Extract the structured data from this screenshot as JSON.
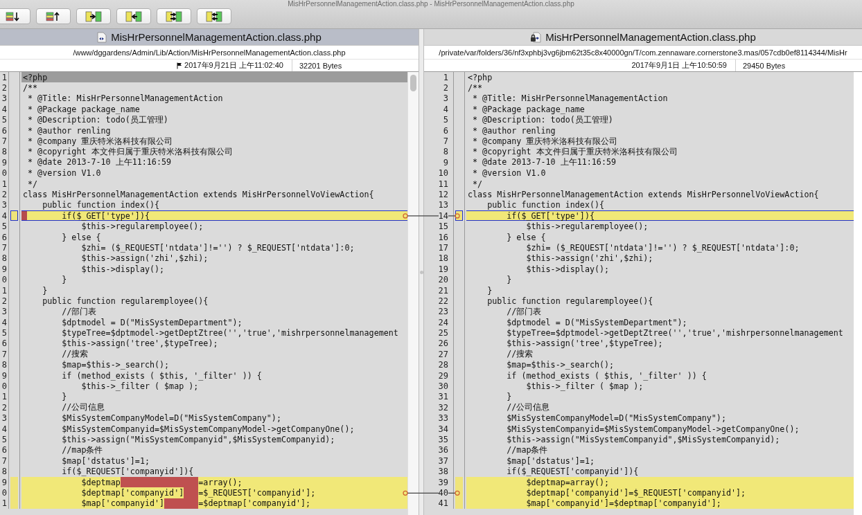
{
  "window": {
    "title": "MisHrPersonnelManagementAction.class.php - MisHrPersonnelManagementAction.class.php"
  },
  "toolbar": {
    "buttons": [
      {
        "kind": "bars-down"
      },
      {
        "kind": "bars-up"
      },
      {
        "kind": "copy-right"
      },
      {
        "kind": "copy-left"
      },
      {
        "kind": "copy-all-right"
      },
      {
        "kind": "copy-all-left"
      }
    ]
  },
  "panes": [
    {
      "active": true,
      "locked": false,
      "flagged": true,
      "file_name": "MisHrPersonnelManagementAction.class.php",
      "path": "/www/dggardens/Admin/Lib/Action/MisHrPersonnelManagementAction.class.php",
      "modified": "2017年9月21日 上午11:02:40",
      "size": "32201 Bytes",
      "scrollbar": true,
      "lines": [
        {
          "number": "1",
          "code": "<?php",
          "kind": "current",
          "linked": false
        },
        {
          "number": "2",
          "code": "/**",
          "kind": "plain",
          "linked": false
        },
        {
          "number": "3",
          "code": " * @Title: MisHrPersonnelManagementAction",
          "kind": "plain",
          "linked": false
        },
        {
          "number": "4",
          "code": " * @Package package_name",
          "kind": "plain",
          "linked": false
        },
        {
          "number": "5",
          "code": " * @Description: todo(员工管理)",
          "kind": "plain",
          "linked": false
        },
        {
          "number": "6",
          "code": " * @author renling",
          "kind": "plain",
          "linked": false
        },
        {
          "number": "7",
          "code": " * @company 重庆特米洛科技有限公司",
          "kind": "plain",
          "linked": false
        },
        {
          "number": "8",
          "code": " * @copyright 本文件归属于重庆特米洛科技有限公司",
          "kind": "plain",
          "linked": false
        },
        {
          "number": "9",
          "code": " * @date 2013-7-10 上午11:16:59",
          "kind": "plain",
          "linked": false
        },
        {
          "number": "0",
          "code": " * @version V1.0",
          "kind": "plain",
          "linked": false
        },
        {
          "number": "1",
          "code": " */",
          "kind": "plain",
          "linked": false
        },
        {
          "number": "2",
          "code": "class MisHrPersonnelManagementAction extends MisHrPersonnelVoViewAction{",
          "kind": "plain",
          "linked": false
        },
        {
          "number": "3",
          "code": "    public function index(){",
          "kind": "plain",
          "linked": false
        },
        {
          "number": "4",
          "code": "        if($_GET['type']){",
          "kind": "selected-marked",
          "linked": true
        },
        {
          "number": "5",
          "code": "            $this->regularemployee();",
          "kind": "plain",
          "linked": false
        },
        {
          "number": "6",
          "code": "        } else {",
          "kind": "plain",
          "linked": false
        },
        {
          "number": "7",
          "code": "            $zhi= ($_REQUEST['ntdata']!='') ? $_REQUEST['ntdata']:0;",
          "kind": "plain",
          "linked": false
        },
        {
          "number": "8",
          "code": "            $this->assign('zhi',$zhi);",
          "kind": "plain",
          "linked": false
        },
        {
          "number": "9",
          "code": "            $this->display();",
          "kind": "plain",
          "linked": false
        },
        {
          "number": "0",
          "code": "        }",
          "kind": "plain",
          "linked": false
        },
        {
          "number": "1",
          "code": "    }",
          "kind": "plain",
          "linked": false
        },
        {
          "number": "2",
          "code": "    public function regularemployee(){",
          "kind": "plain",
          "linked": false
        },
        {
          "number": "3",
          "code": "        //部门表",
          "kind": "plain",
          "linked": false
        },
        {
          "number": "4",
          "code": "        $dptmodel = D(\"MisSystemDepartment\");",
          "kind": "plain",
          "linked": false
        },
        {
          "number": "5",
          "code": "        $typeTree=$dptmodel->getDeptZtree('','true','mishrpersonnelmanagement",
          "kind": "plain",
          "linked": false
        },
        {
          "number": "6",
          "code": "        $this->assign('tree',$typeTree);",
          "kind": "plain",
          "linked": false
        },
        {
          "number": "7",
          "code": "        //搜索",
          "kind": "plain",
          "linked": false
        },
        {
          "number": "8",
          "code": "        $map=$this->_search();",
          "kind": "plain",
          "linked": false
        },
        {
          "number": "9",
          "code": "        if (method_exists ( $this, '_filter' )) {",
          "kind": "plain",
          "linked": false
        },
        {
          "number": "0",
          "code": "            $this->_filter ( $map );",
          "kind": "plain",
          "linked": false
        },
        {
          "number": "1",
          "code": "        }",
          "kind": "plain",
          "linked": false
        },
        {
          "number": "2",
          "code": "        //公司信息",
          "kind": "plain",
          "linked": false
        },
        {
          "number": "3",
          "code": "        $MisSystemCompanyModel=D(\"MisSystemCompany\");",
          "kind": "plain",
          "linked": false
        },
        {
          "number": "4",
          "code": "        $MisSystemCompanyid=$MisSystemCompanyModel->getCompanyOne();",
          "kind": "plain",
          "linked": false
        },
        {
          "number": "5",
          "code": "        $this->assign(\"MisSystemCompanyid\",$MisSystemCompanyid);",
          "kind": "plain",
          "linked": false
        },
        {
          "number": "6",
          "code": "        //map条件",
          "kind": "plain",
          "linked": false
        },
        {
          "number": "7",
          "code": "        $map['dstatus']=1;",
          "kind": "plain",
          "linked": false
        },
        {
          "number": "8",
          "code": "        if($_REQUEST['companyid']){",
          "kind": "plain",
          "linked": false
        },
        {
          "number": "9",
          "parts": [
            {
              "kind": "text",
              "text": "            $deptmap"
            },
            {
              "kind": "redaction"
            },
            {
              "kind": "text",
              "text": "=array();"
            }
          ],
          "kind": "changed",
          "linked": false
        },
        {
          "number": "0",
          "parts": [
            {
              "kind": "text",
              "text": "            $deptmap['companyid']"
            },
            {
              "kind": "redaction"
            },
            {
              "kind": "text",
              "text": "=$_REQUEST['companyid'];"
            }
          ],
          "kind": "changed",
          "linked": true
        },
        {
          "number": "1",
          "parts": [
            {
              "kind": "text",
              "text": "            $map['companyid']"
            },
            {
              "kind": "redaction"
            },
            {
              "kind": "text",
              "text": "=$deptmap['companyid'];"
            }
          ],
          "kind": "changed",
          "linked": false
        }
      ]
    },
    {
      "active": false,
      "locked": true,
      "flagged": false,
      "file_name": "MisHrPersonnelManagementAction.class.php",
      "path": "/private/var/folders/36/nf3xphbj3vg6jbm62t35c8x40000gn/T/com.zennaware.cornerstone3.mas/057cdb0ef8114344/MisHr",
      "modified": "2017年9月1日 上午10:50:59",
      "size": "29450 Bytes",
      "lines": [
        {
          "number": "1",
          "code": "<?php",
          "kind": "plain",
          "linked": false
        },
        {
          "number": "2",
          "code": "/**",
          "kind": "plain",
          "linked": false
        },
        {
          "number": "3",
          "code": " * @Title: MisHrPersonnelManagementAction",
          "kind": "plain",
          "linked": false
        },
        {
          "number": "4",
          "code": " * @Package package_name",
          "kind": "plain",
          "linked": false
        },
        {
          "number": "5",
          "code": " * @Description: todo(员工管理)",
          "kind": "plain",
          "linked": false
        },
        {
          "number": "6",
          "code": " * @author renling",
          "kind": "plain",
          "linked": false
        },
        {
          "number": "7",
          "code": " * @company 重庆特米洛科技有限公司",
          "kind": "plain",
          "linked": false
        },
        {
          "number": "8",
          "code": " * @copyright 本文件归属于重庆特米洛科技有限公司",
          "kind": "plain",
          "linked": false
        },
        {
          "number": "9",
          "code": " * @date 2013-7-10 上午11:16:59",
          "kind": "plain",
          "linked": false
        },
        {
          "number": "10",
          "code": " * @version V1.0",
          "kind": "plain",
          "linked": false
        },
        {
          "number": "11",
          "code": " */",
          "kind": "plain",
          "linked": false
        },
        {
          "number": "12",
          "code": "class MisHrPersonnelManagementAction extends MisHrPersonnelVoViewAction{",
          "kind": "plain",
          "linked": false
        },
        {
          "number": "13",
          "code": "    public function index(){",
          "kind": "plain",
          "linked": false
        },
        {
          "number": "14",
          "code": "        if($_GET['type']){",
          "kind": "selected",
          "linked": true
        },
        {
          "number": "15",
          "code": "            $this->regularemployee();",
          "kind": "plain",
          "linked": false
        },
        {
          "number": "16",
          "code": "        } else {",
          "kind": "plain",
          "linked": false
        },
        {
          "number": "17",
          "code": "            $zhi= ($_REQUEST['ntdata']!='') ? $_REQUEST['ntdata']:0;",
          "kind": "plain",
          "linked": false
        },
        {
          "number": "18",
          "code": "            $this->assign('zhi',$zhi);",
          "kind": "plain",
          "linked": false
        },
        {
          "number": "19",
          "code": "            $this->display();",
          "kind": "plain",
          "linked": false
        },
        {
          "number": "20",
          "code": "        }",
          "kind": "plain",
          "linked": false
        },
        {
          "number": "21",
          "code": "    }",
          "kind": "plain",
          "linked": false
        },
        {
          "number": "22",
          "code": "    public function regularemployee(){",
          "kind": "plain",
          "linked": false
        },
        {
          "number": "23",
          "code": "        //部门表",
          "kind": "plain",
          "linked": false
        },
        {
          "number": "24",
          "code": "        $dptmodel = D(\"MisSystemDepartment\");",
          "kind": "plain",
          "linked": false
        },
        {
          "number": "25",
          "code": "        $typeTree=$dptmodel->getDeptZtree('','true','mishrpersonnelmanagement",
          "kind": "plain",
          "linked": false
        },
        {
          "number": "26",
          "code": "        $this->assign('tree',$typeTree);",
          "kind": "plain",
          "linked": false
        },
        {
          "number": "27",
          "code": "        //搜索",
          "kind": "plain",
          "linked": false
        },
        {
          "number": "28",
          "code": "        $map=$this->_search();",
          "kind": "plain",
          "linked": false
        },
        {
          "number": "29",
          "code": "        if (method_exists ( $this, '_filter' )) {",
          "kind": "plain",
          "linked": false
        },
        {
          "number": "30",
          "code": "            $this->_filter ( $map );",
          "kind": "plain",
          "linked": false
        },
        {
          "number": "31",
          "code": "        }",
          "kind": "plain",
          "linked": false
        },
        {
          "number": "32",
          "code": "        //公司信息",
          "kind": "plain",
          "linked": false
        },
        {
          "number": "33",
          "code": "        $MisSystemCompanyModel=D(\"MisSystemCompany\");",
          "kind": "plain",
          "linked": false
        },
        {
          "number": "34",
          "code": "        $MisSystemCompanyid=$MisSystemCompanyModel->getCompanyOne();",
          "kind": "plain",
          "linked": false
        },
        {
          "number": "35",
          "code": "        $this->assign(\"MisSystemCompanyid\",$MisSystemCompanyid);",
          "kind": "plain",
          "linked": false
        },
        {
          "number": "36",
          "code": "        //map条件",
          "kind": "plain",
          "linked": false
        },
        {
          "number": "37",
          "code": "        $map['dstatus']=1;",
          "kind": "plain",
          "linked": false
        },
        {
          "number": "38",
          "code": "        if($_REQUEST['companyid']){",
          "kind": "plain",
          "linked": false
        },
        {
          "number": "39",
          "code": "            $deptmap=array();",
          "kind": "changed",
          "linked": false
        },
        {
          "number": "40",
          "code": "            $deptmap['companyid']=$_REQUEST['companyid'];",
          "kind": "changed",
          "linked": true
        },
        {
          "number": "41",
          "code": "            $map['companyid']=$deptmap['companyid'];",
          "kind": "changed",
          "linked": false
        }
      ]
    }
  ]
}
